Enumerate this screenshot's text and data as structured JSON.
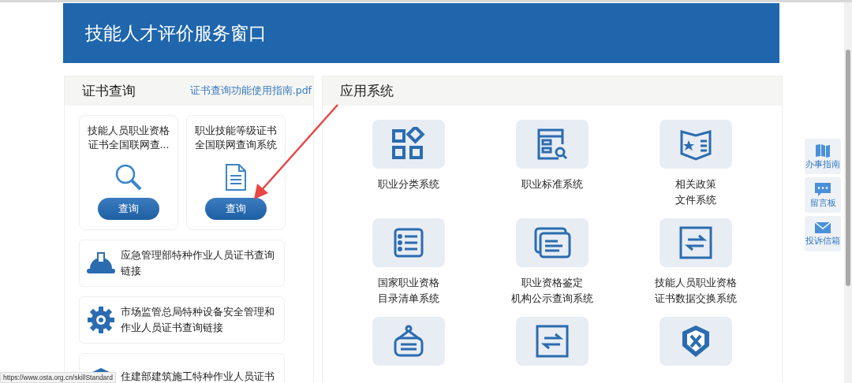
{
  "header": {
    "title": "技能人才评价服务窗口"
  },
  "certificate_panel": {
    "title": "证书查询",
    "guide_link": "证书查询功能使用指南.pdf",
    "cards": [
      {
        "title": "技能人员职业资格证书全国联网查...",
        "button": "查询"
      },
      {
        "title": "职业技能等级证书全国联网查询系统",
        "button": "查询"
      }
    ],
    "links": [
      {
        "text": "应急管理部特种作业人员证书查询链接"
      },
      {
        "text": "市场监管总局特种设备安全管理和作业人员证书查询链接"
      },
      {
        "text": "住建部建筑施工特种作业人员证书"
      }
    ]
  },
  "apps_panel": {
    "title": "应用系统",
    "apps": [
      {
        "kind": "shapes",
        "label_lines": [
          "职业分类系统"
        ]
      },
      {
        "kind": "form",
        "label_lines": [
          "职业标准系统"
        ]
      },
      {
        "kind": "book",
        "label_lines": [
          "相关政策",
          "文件系统"
        ]
      },
      {
        "kind": "list",
        "label_lines": [
          "国家职业资格",
          "目录清单系统"
        ]
      },
      {
        "kind": "cards",
        "label_lines": [
          "职业资格鉴定",
          "机构公示查询系统"
        ]
      },
      {
        "kind": "swap",
        "label_lines": [
          "技能人员职业资格",
          "证书数据交换系统"
        ]
      },
      {
        "kind": "sign"
      },
      {
        "kind": "swap"
      },
      {
        "kind": "shield"
      }
    ]
  },
  "side_tools": [
    {
      "label": "办事指南"
    },
    {
      "label": "留言板"
    },
    {
      "label": "投诉信箱"
    }
  ],
  "status_url": "https://www.osta.org.cn/skillStandard"
}
